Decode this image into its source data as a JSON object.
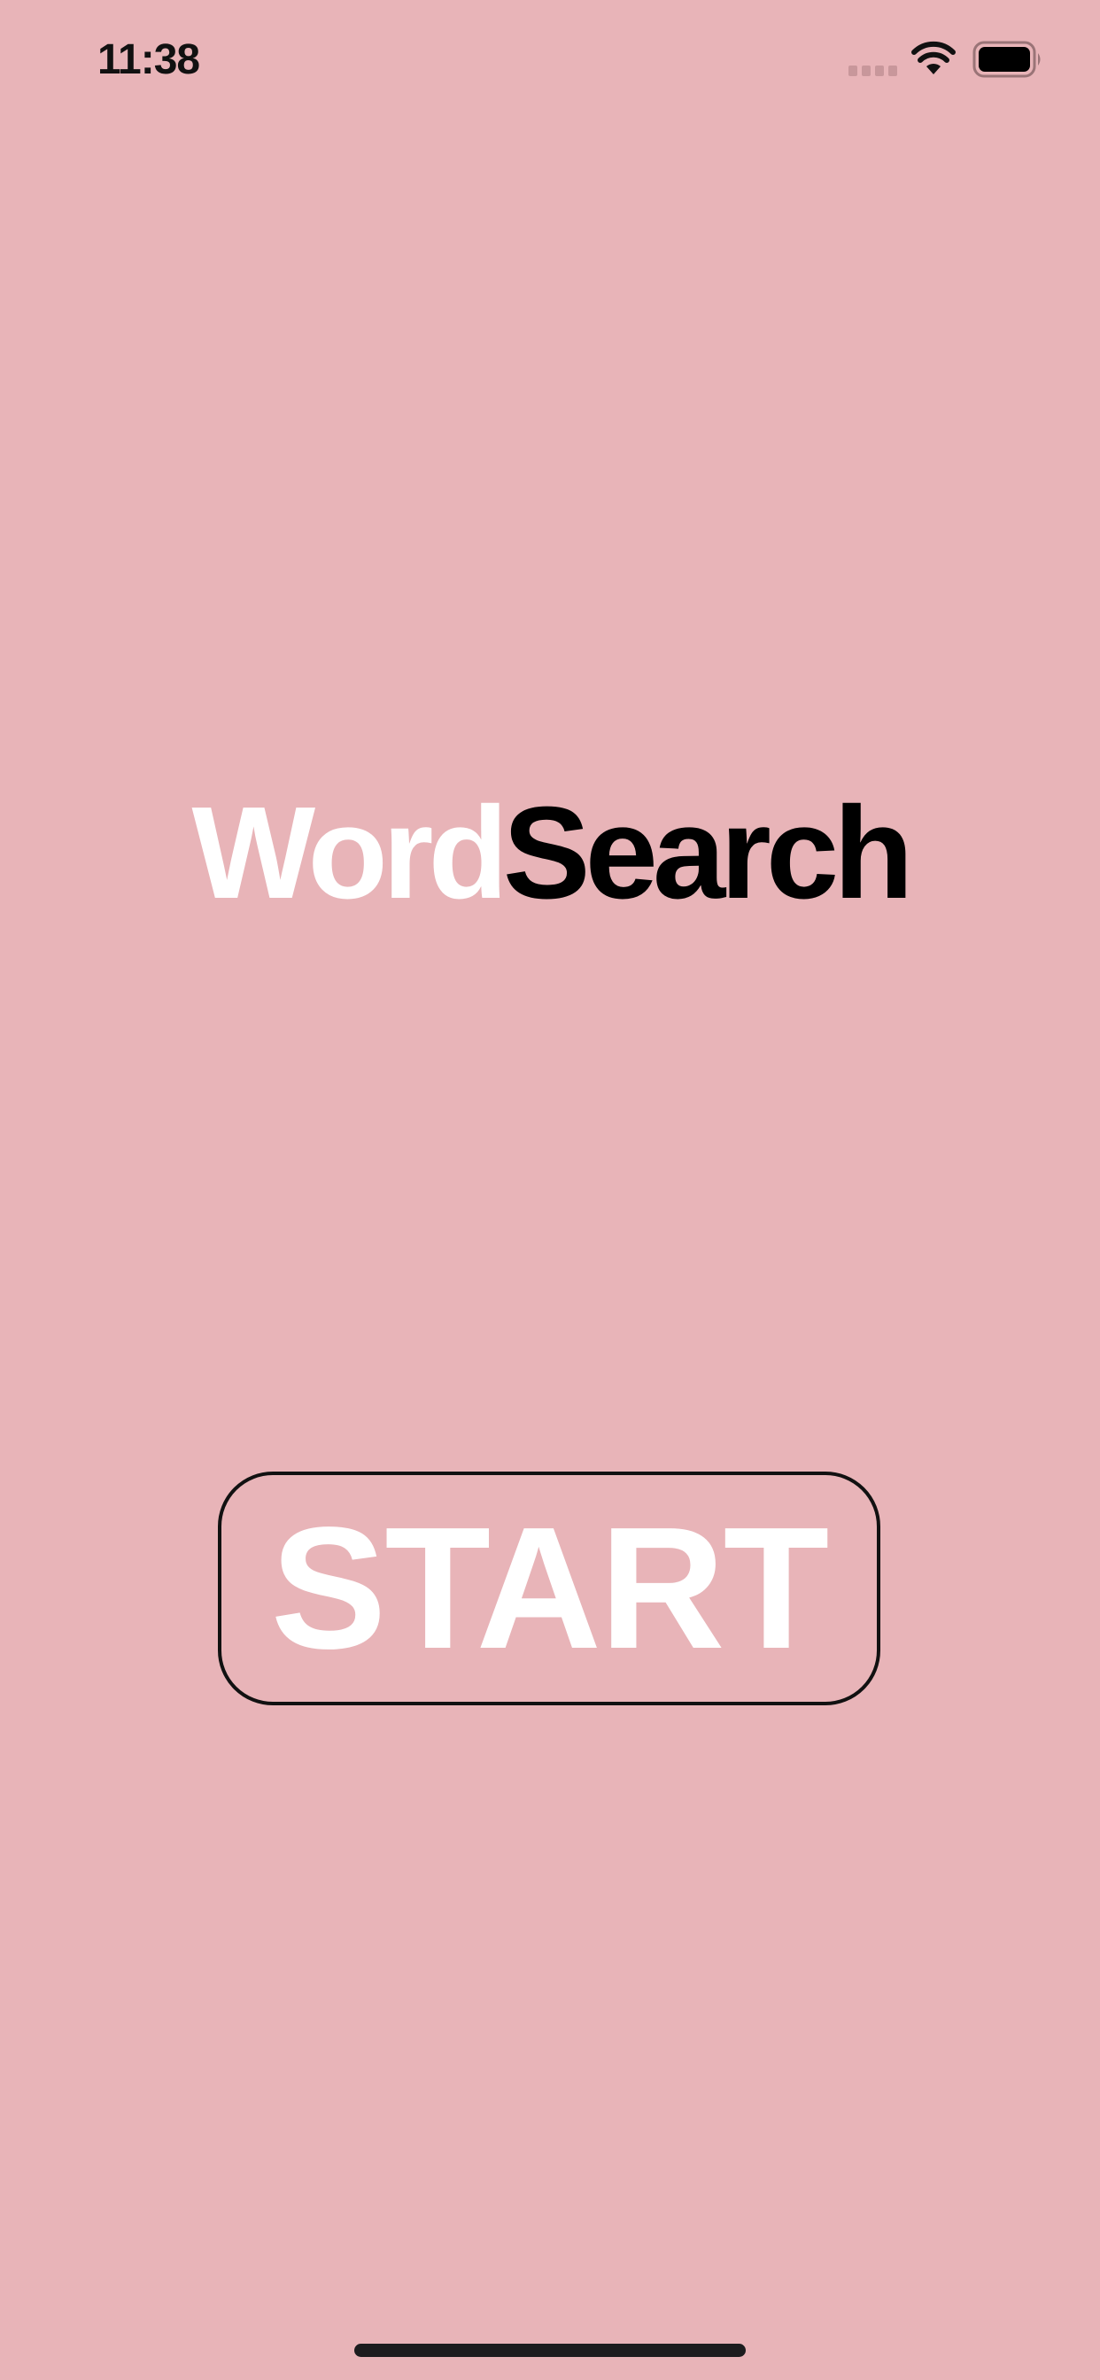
{
  "status_bar": {
    "time": "11:38"
  },
  "title": {
    "part1": "Word",
    "part2": "Search"
  },
  "start_button": {
    "label": "START"
  },
  "colors": {
    "background": "#e8b4b8",
    "title_part1": "#ffffff",
    "title_part2": "#000000",
    "button_border": "#111111",
    "button_text": "#ffffff"
  },
  "icons": [
    "cellular-signal-icon",
    "wifi-icon",
    "battery-icon"
  ]
}
